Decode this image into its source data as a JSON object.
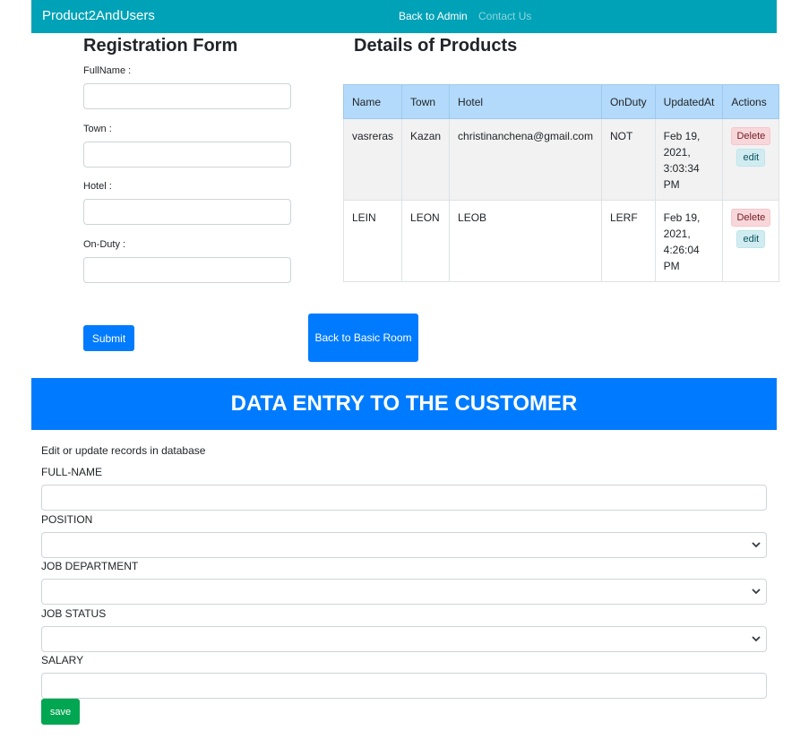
{
  "navbar": {
    "brand": "Product2AndUsers",
    "links": [
      "Back to Admin",
      "Contact Us"
    ]
  },
  "registration": {
    "title": "Registration Form",
    "fields": [
      {
        "label": "FullName :",
        "value": ""
      },
      {
        "label": "Town :",
        "value": ""
      },
      {
        "label": "Hotel :",
        "value": ""
      },
      {
        "label": "On-Duty :",
        "value": ""
      }
    ],
    "submit_label": "Submit",
    "back_label": "Back to Basic Room"
  },
  "products": {
    "title": "Details of Products",
    "columns": [
      "Name",
      "Town",
      "Hotel",
      "OnDuty",
      "UpdatedAt",
      "Actions"
    ],
    "rows": [
      {
        "name": "vasreras",
        "town": "Kazan",
        "hotel": "christinanchena@gmail.com",
        "onduty": "NOT",
        "updated": "Feb 19, 2021, 3:03:34 PM"
      },
      {
        "name": "LEIN",
        "town": "LEON",
        "hotel": "LEOB",
        "onduty": "LERF",
        "updated": "Feb 19, 2021, 4:26:04 PM"
      }
    ],
    "delete_label": "Delete",
    "edit_label": "edit"
  },
  "customer": {
    "banner": "DATA ENTRY TO THE CUSTOMER",
    "hint": "Edit or update records in database",
    "fields": [
      {
        "label": "FULL-NAME",
        "kind": "input",
        "value": ""
      },
      {
        "label": "POSITION",
        "kind": "select",
        "value": ""
      },
      {
        "label": "JOB DEPARTMENT",
        "kind": "select",
        "value": ""
      },
      {
        "label": "JOB STATUS",
        "kind": "select",
        "value": ""
      },
      {
        "label": "SALARY",
        "kind": "input",
        "value": ""
      }
    ],
    "save_label": "save"
  },
  "colors": {
    "navbar": "#00a2b7",
    "primary": "#007bff",
    "table_header": "#b3dafa",
    "save": "#00a651"
  }
}
